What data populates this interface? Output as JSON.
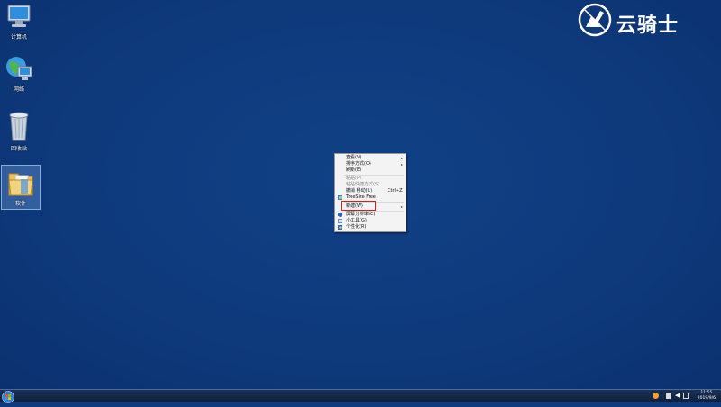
{
  "desktop": {
    "icons": [
      {
        "label": "计算机",
        "icon": "computer-icon"
      },
      {
        "label": "网络",
        "icon": "network-icon"
      },
      {
        "label": "回收站",
        "icon": "recycle-bin-icon"
      },
      {
        "label": "软件",
        "icon": "folder-icon"
      }
    ]
  },
  "watermark": {
    "text": "云骑士",
    "icon": "knight-logo"
  },
  "context_menu": {
    "items": [
      {
        "label": "查看(V)",
        "has_submenu": true
      },
      {
        "label": "排序方式(O)",
        "has_submenu": true
      },
      {
        "label": "刷新(E)"
      },
      {
        "label": "粘贴(P)",
        "disabled": true
      },
      {
        "label": "粘贴快捷方式(S)",
        "disabled": true
      },
      {
        "label": "撤消 移动(U)",
        "shortcut": "Ctrl+Z"
      },
      {
        "label": "TreeSize Free",
        "icon": "treesize-icon"
      },
      {
        "label": "新建(W)",
        "has_submenu": true,
        "highlighted": true
      },
      {
        "label": "屏幕分辨率(C)",
        "icon": "screen-resolution-icon"
      },
      {
        "label": "小工具(G)",
        "icon": "gadgets-icon"
      },
      {
        "label": "个性化(R)",
        "icon": "personalize-icon"
      }
    ]
  },
  "taskbar": {
    "start_icon": "windows-start-icon",
    "clock_time": "11:55",
    "clock_date": "2019/9/6"
  },
  "colors": {
    "desktop": "#0f3a7d",
    "highlight_box": "#e01818"
  }
}
